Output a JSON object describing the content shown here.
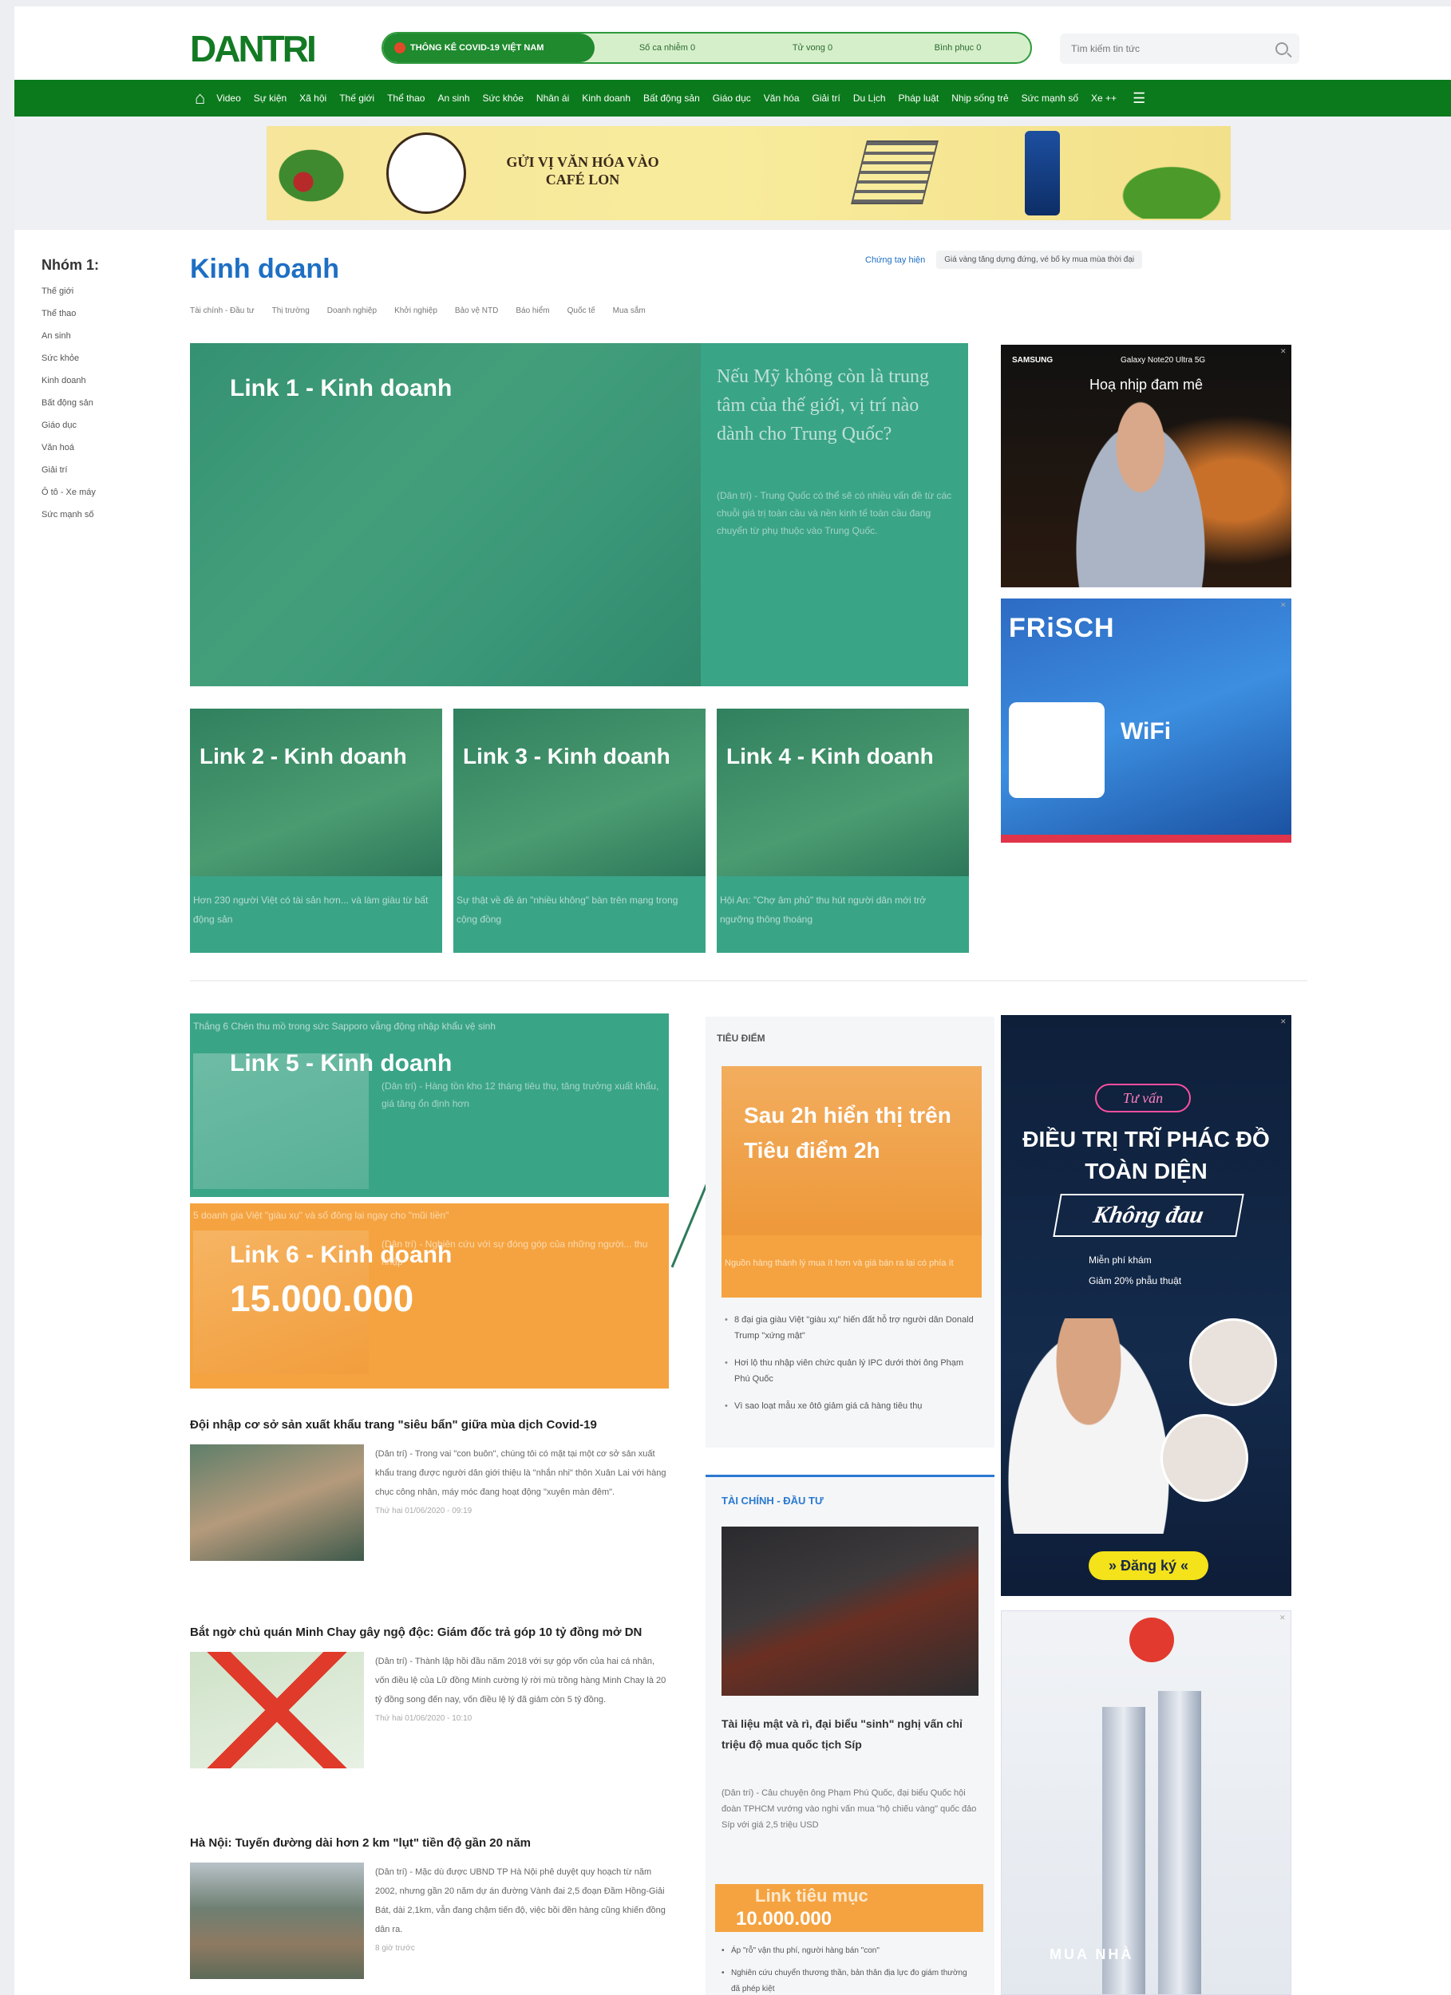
{
  "header": {
    "logo": "DANTRI",
    "trend": {
      "main_label": "THÔNG KÊ COVID-19 VIỆT NAM",
      "stats": [
        "Số ca nhiễm 0",
        "Tử vong 0",
        "Bình phục 0"
      ]
    },
    "search_placeholder": "Tìm kiếm tin tức"
  },
  "nav": {
    "items": [
      "Video",
      "Sự kiện",
      "Xã hội",
      "Thế giới",
      "Thể thao",
      "An sinh",
      "Sức khỏe",
      "Nhân ái",
      "Kinh doanh",
      "Bất động sản",
      "Giáo dục",
      "Văn hóa",
      "Giải trí",
      "Du Lịch",
      "Pháp luật",
      "Nhịp sống trẻ",
      "Sức mạnh số",
      "Xe ++"
    ]
  },
  "banner": {
    "slogan": "GỬI VỊ VĂN HÓA VÀO CAFÉ LON"
  },
  "sidebar": {
    "heading": "Nhóm 1:",
    "items": [
      "Thế giới",
      "Thể thao",
      "An sinh",
      "Sức khỏe",
      "Kinh doanh",
      "Bất động sản",
      "Giáo dục",
      "Văn hoá",
      "Giải trí",
      "Ô tô - Xe máy",
      "Sức mạnh số"
    ]
  },
  "section": {
    "title": "Kinh doanh",
    "link": "Chứng tay hiện",
    "pill": "Giá vàng tăng dựng đứng, vé bố ky mua mùa thời đại",
    "subnav": [
      "Tài chính - Đầu tư",
      "Thị trường",
      "Doanh nghiệp",
      "Khởi nghiệp",
      "Bảo vệ NTD",
      "Báo hiểm",
      "Quốc tế",
      "Mua sắm"
    ]
  },
  "cards": {
    "hero": {
      "label": "Link 1 - Kinh doanh",
      "headline": "Nếu Mỹ không còn là trung tâm của thế giới, vị trí nào dành cho Trung Quốc?",
      "sapo": "(Dân trí) - Trung Quốc có thể sẽ có nhiều vấn đề từ các chuỗi giá trị toàn cầu và nền kinh tế toàn cầu đang chuyển từ phụ thuộc vào Trung Quốc."
    },
    "small": [
      {
        "label": "Link 2 - Kinh doanh",
        "sapo": "Hơn 230 người Việt có tài sản hơn... và làm giàu từ bất động sản"
      },
      {
        "label": "Link 3 - Kinh doanh",
        "sapo": "Sự thật về đề án \"nhiều không\" bàn trên mạng trong cộng đồng"
      },
      {
        "label": "Link 4 - Kinh doanh",
        "sapo": "Hội An: \"Chợ âm phủ\" thu hút người dân mới trở ngưỡng thông thoáng"
      }
    ],
    "card5": {
      "label": "Link 5 - Kinh doanh",
      "top": "Thắng 6 Chén thu mồ trong sức Sapporo vẫng động nhập khẩu vệ sinh",
      "sapo": "(Dân trí) - Hàng tồn kho 12 tháng tiêu thụ, tăng trưởng xuất khẩu, giá tăng ổn định hơn"
    },
    "card6": {
      "label": "Link 6 - Kinh doanh",
      "price": "15.000.000",
      "top": "5 doanh gia Việt \"giàu xụ\" và số đông lại ngay cho \"mũi tiền\"",
      "sapo": "(Dân trí) - Nghiên cứu với sự đóng góp của những người... thu nhập"
    }
  },
  "focus": {
    "label": "TIÊU ĐIỂM",
    "card_label": "Sau 2h hiển thị trên Tiêu điểm 2h",
    "card_sapo": "Nguồn hàng thành lý mua ít hơn và giá bán ra lại có phía ít",
    "items": [
      "8 đại gia giàu Việt \"giàu xụ\" hiến đất hỗ trợ người dân Donald Trump \"xứng mật\"",
      "Hơi lộ thu nhập viên chức quản lý IPC dưới thời ông Phạm Phú Quốc",
      "Vì sao loạt mẫu xe ôtô giảm giá cả hàng tiêu thụ"
    ]
  },
  "finance": {
    "label": "TÀI CHÍNH - ĐẦU TƯ",
    "title": "Tài liệu mật và rì, đại biểu \"sinh\" nghị vấn chỉ triệu độ mua quốc tịch Síp",
    "sapo": "(Dân trí) - Câu chuyện ông Phạm Phú Quốc, đại biểu Quốc hội đoàn TPHCM vướng vào nghi vấn mua \"hộ chiếu vàng\" quốc đảo Síp với giá 2,5 triệu USD",
    "orange_label": "Link tiêu mục",
    "orange_price": "10.000.000",
    "items": [
      "Áp \"rỗ\" vận thu phí, người hàng bán \"con\"",
      "Nghiên cứu chuyển thương thần, bản thân địa lực đo giám thường đã phép kiệt"
    ]
  },
  "articles": [
    {
      "title": "Đội nhập cơ sở sản xuất khẩu trang \"siêu bẩn\" giữa mùa dịch Covid-19",
      "sapo": "(Dân trí) - Trong vai \"con buôn\", chúng tôi có mặt tại một cơ sở sản xuất khẩu trang được người dân giới thiệu là \"nhắn nhi\" thôn Xuân Lai với hàng chục công nhân, máy móc đang hoạt động \"xuyên màn đêm\".",
      "meta": "Thứ hai 01/06/2020 - 09:19"
    },
    {
      "title": "Bắt ngờ chủ quán Minh Chay gây ngộ độc: Giám đốc trả góp 10 tỷ đồng mở DN",
      "sapo": "(Dân trí) - Thành lập hồi đầu năm 2018 với sự góp vốn của hai cá nhân, vốn điều lệ của Lữ đồng Minh cường lý rời mù trồng hàng Minh Chay là 20 tỷ đồng song đến nay, vốn điều lệ lý đã giảm còn 5 tỷ đồng.",
      "meta": "Thứ hai 01/06/2020 - 10:10"
    },
    {
      "title": "Hà Nội: Tuyến đường dài hơn 2 km \"lụt\" tiền độ gần 20 năm",
      "sapo": "(Dân trí) - Mặc dù được UBND TP Hà Nội phê duyệt quy hoạch từ năm 2002, nhưng gần 20 năm dự án đường Vành đai 2,5 đoạn Đầm Hồng-Giải Bát, dài 2,1km, vẫn đang chậm tiến độ, việc bồi đền hàng cũng khiến đồng dân ra.",
      "meta": "8 giờ trước"
    }
  ],
  "ads": {
    "ad1": {
      "brand": "SAMSUNG",
      "sub": "Galaxy Note20 Ultra 5G",
      "tag": "Hoạ nhịp đam mê"
    },
    "ad2": {
      "brand": "FRiSCH",
      "wifi": "WiFi"
    },
    "ad3": {
      "pill": "Tư vấn",
      "headline": "ĐIỀU TRỊ TRĨ PHÁC ĐỒ TOÀN DIỆN",
      "script": "Không đau",
      "perk1": "Miễn phí khám",
      "perk2": "Giảm 20% phẫu thuật",
      "cta": "» Đăng ký «"
    },
    "ad4": {
      "label": "MUA NHÀ"
    }
  },
  "colors": {
    "brand_green": "#0b7a1c",
    "card_teal": "#3aa487",
    "card_orange": "#f5a340",
    "title_blue": "#1e6fc4"
  }
}
